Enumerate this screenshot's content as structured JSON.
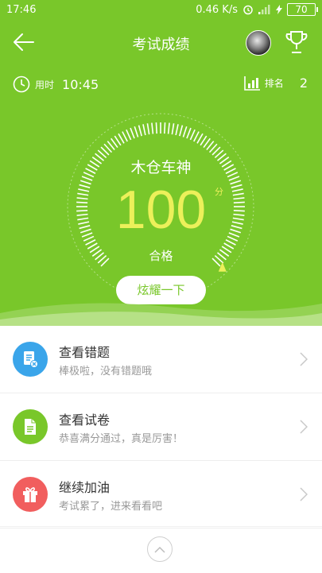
{
  "status_bar": {
    "time": "17:46",
    "net_speed": "0.46 K/s",
    "battery": "70"
  },
  "header": {
    "title": "考试成绩"
  },
  "summary": {
    "time_label": "用时",
    "time_value": "10:45",
    "rank_label": "排名",
    "rank_value": "2"
  },
  "result": {
    "name": "木仓车神",
    "score": "100",
    "unit": "分",
    "status": "合格",
    "share_label": "炫耀一下",
    "score_fraction": 1.0
  },
  "menu": [
    {
      "title": "查看错题",
      "subtitle": "棒极啦，没有错题哦",
      "icon": "wrong-questions-icon",
      "color": "#3aa5ea"
    },
    {
      "title": "查看试卷",
      "subtitle": "恭喜满分通过，真是厉害！",
      "icon": "exam-paper-icon",
      "color": "#79c72a"
    },
    {
      "title": "继续加油",
      "subtitle": "考试累了，进来看看吧",
      "icon": "gift-icon",
      "color": "#f15e5e"
    }
  ],
  "colors": {
    "accent": "#79c72a",
    "score": "#ecf05a"
  }
}
